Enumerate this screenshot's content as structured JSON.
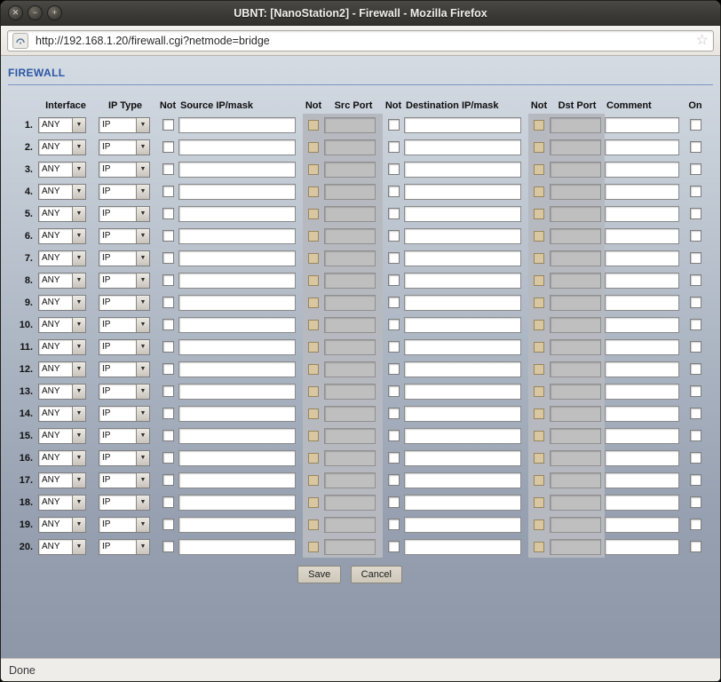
{
  "window": {
    "title": "UBNT: [NanoStation2] - Firewall - Mozilla Firefox",
    "icons": {
      "close": "✕",
      "minimize": "−",
      "maximize": "+"
    }
  },
  "browser": {
    "url": "http://192.168.1.20/firewall.cgi?netmode=bridge",
    "bookmark_star": "☆",
    "site_icon": "ubnt-favicon"
  },
  "page": {
    "heading": "FIREWALL",
    "table": {
      "headers": {
        "interface": "Interface",
        "ip_type": "IP Type",
        "not": "Not",
        "source": "Source IP/mask",
        "src_port": "Src Port",
        "dest": "Destination IP/mask",
        "dst_port": "Dst Port",
        "comment": "Comment",
        "on": "On"
      },
      "rows": [
        {
          "num": "1.",
          "interface": "ANY",
          "ip_type": "IP",
          "not_source": false,
          "source": "",
          "not_src_port": false,
          "src_port": "",
          "not_dest": false,
          "dest": "",
          "not_dst_port": false,
          "dst_port": "",
          "comment": "",
          "on": false
        },
        {
          "num": "2.",
          "interface": "ANY",
          "ip_type": "IP",
          "not_source": false,
          "source": "",
          "not_src_port": false,
          "src_port": "",
          "not_dest": false,
          "dest": "",
          "not_dst_port": false,
          "dst_port": "",
          "comment": "",
          "on": false
        },
        {
          "num": "3.",
          "interface": "ANY",
          "ip_type": "IP",
          "not_source": false,
          "source": "",
          "not_src_port": false,
          "src_port": "",
          "not_dest": false,
          "dest": "",
          "not_dst_port": false,
          "dst_port": "",
          "comment": "",
          "on": false
        },
        {
          "num": "4.",
          "interface": "ANY",
          "ip_type": "IP",
          "not_source": false,
          "source": "",
          "not_src_port": false,
          "src_port": "",
          "not_dest": false,
          "dest": "",
          "not_dst_port": false,
          "dst_port": "",
          "comment": "",
          "on": false
        },
        {
          "num": "5.",
          "interface": "ANY",
          "ip_type": "IP",
          "not_source": false,
          "source": "",
          "not_src_port": false,
          "src_port": "",
          "not_dest": false,
          "dest": "",
          "not_dst_port": false,
          "dst_port": "",
          "comment": "",
          "on": false
        },
        {
          "num": "6.",
          "interface": "ANY",
          "ip_type": "IP",
          "not_source": false,
          "source": "",
          "not_src_port": false,
          "src_port": "",
          "not_dest": false,
          "dest": "",
          "not_dst_port": false,
          "dst_port": "",
          "comment": "",
          "on": false
        },
        {
          "num": "7.",
          "interface": "ANY",
          "ip_type": "IP",
          "not_source": false,
          "source": "",
          "not_src_port": false,
          "src_port": "",
          "not_dest": false,
          "dest": "",
          "not_dst_port": false,
          "dst_port": "",
          "comment": "",
          "on": false
        },
        {
          "num": "8.",
          "interface": "ANY",
          "ip_type": "IP",
          "not_source": false,
          "source": "",
          "not_src_port": false,
          "src_port": "",
          "not_dest": false,
          "dest": "",
          "not_dst_port": false,
          "dst_port": "",
          "comment": "",
          "on": false
        },
        {
          "num": "9.",
          "interface": "ANY",
          "ip_type": "IP",
          "not_source": false,
          "source": "",
          "not_src_port": false,
          "src_port": "",
          "not_dest": false,
          "dest": "",
          "not_dst_port": false,
          "dst_port": "",
          "comment": "",
          "on": false
        },
        {
          "num": "10.",
          "interface": "ANY",
          "ip_type": "IP",
          "not_source": false,
          "source": "",
          "not_src_port": false,
          "src_port": "",
          "not_dest": false,
          "dest": "",
          "not_dst_port": false,
          "dst_port": "",
          "comment": "",
          "on": false
        },
        {
          "num": "11.",
          "interface": "ANY",
          "ip_type": "IP",
          "not_source": false,
          "source": "",
          "not_src_port": false,
          "src_port": "",
          "not_dest": false,
          "dest": "",
          "not_dst_port": false,
          "dst_port": "",
          "comment": "",
          "on": false
        },
        {
          "num": "12.",
          "interface": "ANY",
          "ip_type": "IP",
          "not_source": false,
          "source": "",
          "not_src_port": false,
          "src_port": "",
          "not_dest": false,
          "dest": "",
          "not_dst_port": false,
          "dst_port": "",
          "comment": "",
          "on": false
        },
        {
          "num": "13.",
          "interface": "ANY",
          "ip_type": "IP",
          "not_source": false,
          "source": "",
          "not_src_port": false,
          "src_port": "",
          "not_dest": false,
          "dest": "",
          "not_dst_port": false,
          "dst_port": "",
          "comment": "",
          "on": false
        },
        {
          "num": "14.",
          "interface": "ANY",
          "ip_type": "IP",
          "not_source": false,
          "source": "",
          "not_src_port": false,
          "src_port": "",
          "not_dest": false,
          "dest": "",
          "not_dst_port": false,
          "dst_port": "",
          "comment": "",
          "on": false
        },
        {
          "num": "15.",
          "interface": "ANY",
          "ip_type": "IP",
          "not_source": false,
          "source": "",
          "not_src_port": false,
          "src_port": "",
          "not_dest": false,
          "dest": "",
          "not_dst_port": false,
          "dst_port": "",
          "comment": "",
          "on": false
        },
        {
          "num": "16.",
          "interface": "ANY",
          "ip_type": "IP",
          "not_source": false,
          "source": "",
          "not_src_port": false,
          "src_port": "",
          "not_dest": false,
          "dest": "",
          "not_dst_port": false,
          "dst_port": "",
          "comment": "",
          "on": false
        },
        {
          "num": "17.",
          "interface": "ANY",
          "ip_type": "IP",
          "not_source": false,
          "source": "",
          "not_src_port": false,
          "src_port": "",
          "not_dest": false,
          "dest": "",
          "not_dst_port": false,
          "dst_port": "",
          "comment": "",
          "on": false
        },
        {
          "num": "18.",
          "interface": "ANY",
          "ip_type": "IP",
          "not_source": false,
          "source": "",
          "not_src_port": false,
          "src_port": "",
          "not_dest": false,
          "dest": "",
          "not_dst_port": false,
          "dst_port": "",
          "comment": "",
          "on": false
        },
        {
          "num": "19.",
          "interface": "ANY",
          "ip_type": "IP",
          "not_source": false,
          "source": "",
          "not_src_port": false,
          "src_port": "",
          "not_dest": false,
          "dest": "",
          "not_dst_port": false,
          "dst_port": "",
          "comment": "",
          "on": false
        },
        {
          "num": "20.",
          "interface": "ANY",
          "ip_type": "IP",
          "not_source": false,
          "source": "",
          "not_src_port": false,
          "src_port": "",
          "not_dest": false,
          "dest": "",
          "not_dst_port": false,
          "dst_port": "",
          "comment": "",
          "on": false
        }
      ]
    },
    "buttons": {
      "save": "Save",
      "cancel": "Cancel"
    }
  },
  "statusbar": {
    "text": "Done"
  },
  "colors": {
    "heading_blue": "#2a57a5",
    "disabled_field_bg": "#bfbfbf",
    "disabled_checkbox_bg": "#d8c7a1",
    "column_stripe": "#b6bac0",
    "titlebar_bg": "#3a3935"
  }
}
